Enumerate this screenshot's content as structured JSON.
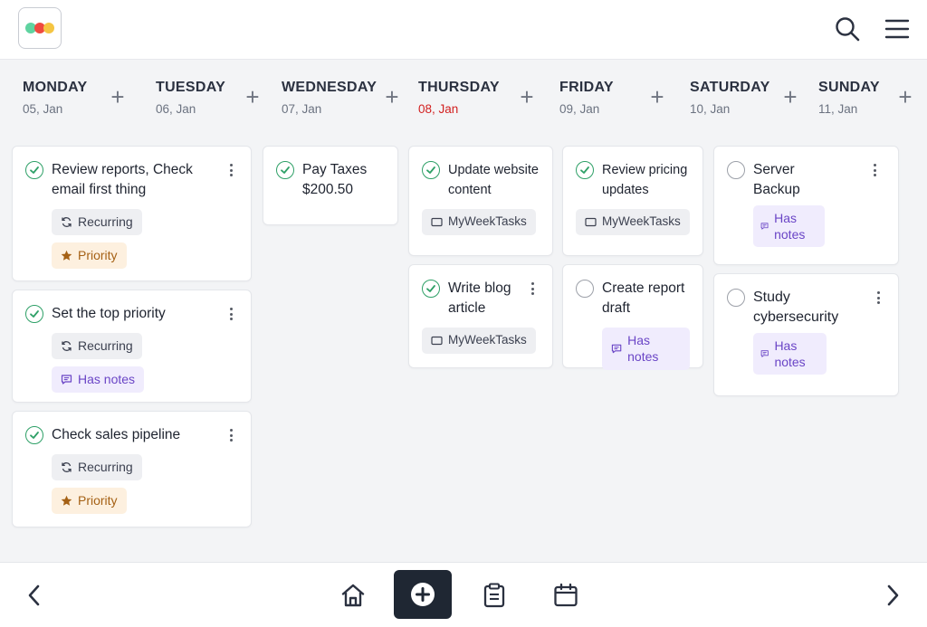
{
  "app": {
    "logo_colors": [
      "#5fd3a0",
      "#ef4a40",
      "#f5c542"
    ]
  },
  "header": {
    "icons": [
      "search-icon",
      "menu-icon"
    ]
  },
  "days": [
    {
      "name": "MONDAY",
      "date": "05, Jan",
      "today": false
    },
    {
      "name": "TUESDAY",
      "date": "06, Jan",
      "today": false
    },
    {
      "name": "WEDNESDAY",
      "date": "07, Jan",
      "today": false
    },
    {
      "name": "THURSDAY",
      "date": "08, Jan",
      "today": true
    },
    {
      "name": "FRIDAY",
      "date": "09, Jan",
      "today": false
    },
    {
      "name": "SATURDAY",
      "date": "10, Jan",
      "today": false
    },
    {
      "name": "SUNDAY",
      "date": "11, Jan",
      "today": false
    }
  ],
  "add_day_label": "+",
  "columns": {
    "monday": [
      {
        "title": "Review reports, Check email first thing",
        "done": true,
        "tags": [
          "Recurring",
          "Priority"
        ]
      },
      {
        "title": "Set the top priority",
        "done": true,
        "tags": [
          "Recurring",
          "Has notes"
        ]
      },
      {
        "title": "Check sales pipeline",
        "done": true,
        "tags": [
          "Recurring",
          "Priority"
        ]
      }
    ],
    "wednesday": [
      {
        "title": "Pay Taxes $200.50",
        "done": true,
        "tags": []
      }
    ],
    "thursday": [
      {
        "title": "Update website content",
        "done": true,
        "tags": [
          "MyWeekTasks"
        ]
      },
      {
        "title": "Write blog article",
        "done": true,
        "tags": [
          "MyWeekTasks"
        ]
      }
    ],
    "friday": [
      {
        "title": "Review pricing updates",
        "done": true,
        "tags": [
          "MyWeekTasks"
        ]
      },
      {
        "title": "Create report draft",
        "done": false,
        "tags": [
          "Has notes"
        ]
      }
    ],
    "saturday": [
      {
        "title": "Server Backup",
        "done": false,
        "tags": [
          "Has notes"
        ]
      },
      {
        "title": "Study cybersecurity",
        "done": false,
        "tags": [
          "Has notes"
        ]
      }
    ]
  },
  "colors": {
    "done_check": "#2ea067",
    "today_date": "#d21f1f",
    "priority_bg": "#fdf0df",
    "notes_bg": "#f0ecfd",
    "nav_dark": "#1f2733"
  },
  "bottom_nav": [
    "chevron-left-icon",
    "home-icon",
    "add-circle-icon",
    "clipboard-icon",
    "calendar-icon",
    "chevron-right-icon"
  ]
}
